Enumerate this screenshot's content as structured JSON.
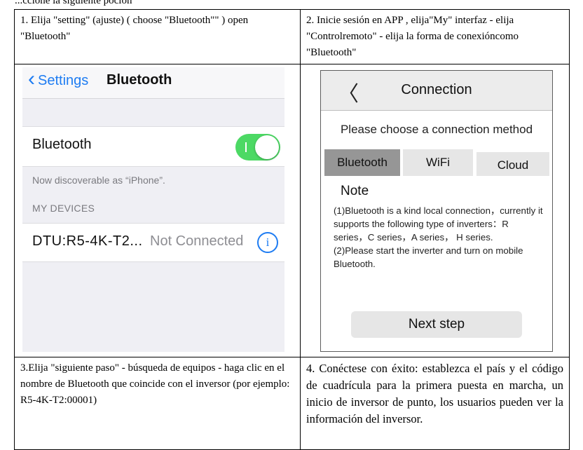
{
  "page": {
    "fragment": "...ccione la siguiente poción"
  },
  "steps": [
    {
      "text": "1. Elija \"setting\" (ajuste) ( choose \"Bluetooth\"\" ) open \"Bluetooth\""
    },
    {
      "text": "2. Inicie sesión en APP , elija\"My\" interfaz - elija \"Controlremoto\" - elija la forma de conexióncomo \"Bluetooth\""
    },
    {
      "text": "3.Elija \"siguiente paso\" - búsqueda de equipos - haga clic en el nombre de Bluetooth que coincide con el inversor (por ejemplo: R5-4K-T2:00001)"
    },
    {
      "text": "4. Conéctese con éxito: establezca el país y el código de cuadrícula para la primera puesta en marcha, un inicio de inversor de punto, los usuarios pueden ver la información del inversor."
    }
  ],
  "ios": {
    "back_label": "Settings",
    "back_icon": "‹",
    "title": "Bluetooth",
    "bluetooth_label": "Bluetooth",
    "toggle_on": true,
    "toggle_color": "#4cd964",
    "discoverable_note": "Now discoverable as “iPhone”.",
    "section_header": "MY DEVICES",
    "device_name": "DTU:R5-4K-T2...",
    "device_status": "Not Connected",
    "info_icon": "i",
    "accent": "#1e7cf2"
  },
  "app": {
    "back_icon": "〈",
    "title": "Connection",
    "prompt": "Please choose a connection method",
    "tabs": [
      "Bluetooth",
      "WiFi",
      "Cloud"
    ],
    "selected_tab": "Bluetooth",
    "note_heading": "Note",
    "note_line1": "(1)Bluetooth is a kind local connection，currently it supports the following type of inverters：R series，C series，A series， H series.",
    "note_line2": "(2)Please start the inverter and turn on mobile Bluetooth.",
    "next_label": "Next step"
  }
}
